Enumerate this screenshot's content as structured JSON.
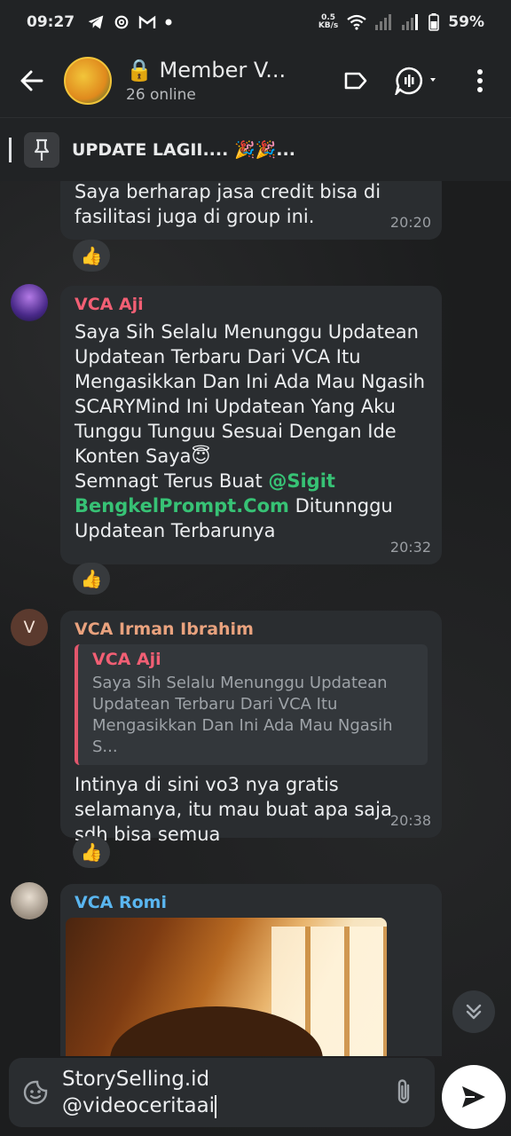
{
  "status_bar": {
    "time": "09:27",
    "net_speed_value": "0.5",
    "net_speed_unit": "KB/s",
    "battery": "59%"
  },
  "header": {
    "title": "Member V...",
    "subtitle": "26 online"
  },
  "pinned": {
    "text": "UPDATE LAGII.... 🎉🎉..."
  },
  "messages": [
    {
      "text": "Saya berharap jasa credit bisa di fasilitasi juga di group ini.",
      "time": "20:20",
      "reaction": "👍"
    },
    {
      "sender": "VCA Aji",
      "sender_color": "#f25f74",
      "text_1": "Saya Sih Selalu Menunggu Updatean Updatean Terbaru Dari VCA Itu Mengasikkan Dan Ini Ada Mau Ngasih SCARYMind Ini Updatean Yang Aku Tunggu Tunguu Sesuai Dengan Ide Konten Saya😇",
      "text_2a": "Semnagt Terus Buat ",
      "link_1": "@Sigit",
      "link_2": "BengkelPrompt.Com",
      "text_2b": "  Ditunnggu Updatean Terbarunya",
      "time": "20:32",
      "reaction": "👍"
    },
    {
      "avatar_letter": "V",
      "sender": "VCA Irman Ibrahim",
      "sender_color": "#e9a27e",
      "quote_name": "VCA Aji",
      "quote_text": "Saya Sih Selalu Menunggu Updatean Updatean Terbaru Dari VCA Itu Mengasikkan Dan Ini Ada Mau Ngasih S...",
      "text": "Intinya di sini vo3 nya gratis selamanya, itu mau buat apa saja sdh bisa semua",
      "time": "20:38",
      "reaction": "👍"
    },
    {
      "sender": "VCA Romi",
      "sender_color": "#5ab6f0"
    }
  ],
  "input": {
    "text": "StorySelling.id\n@videoceritaai"
  },
  "colors": {
    "bar_bg": "#212325",
    "bubble_bg": "#2a2d30",
    "link": "#37c275"
  }
}
